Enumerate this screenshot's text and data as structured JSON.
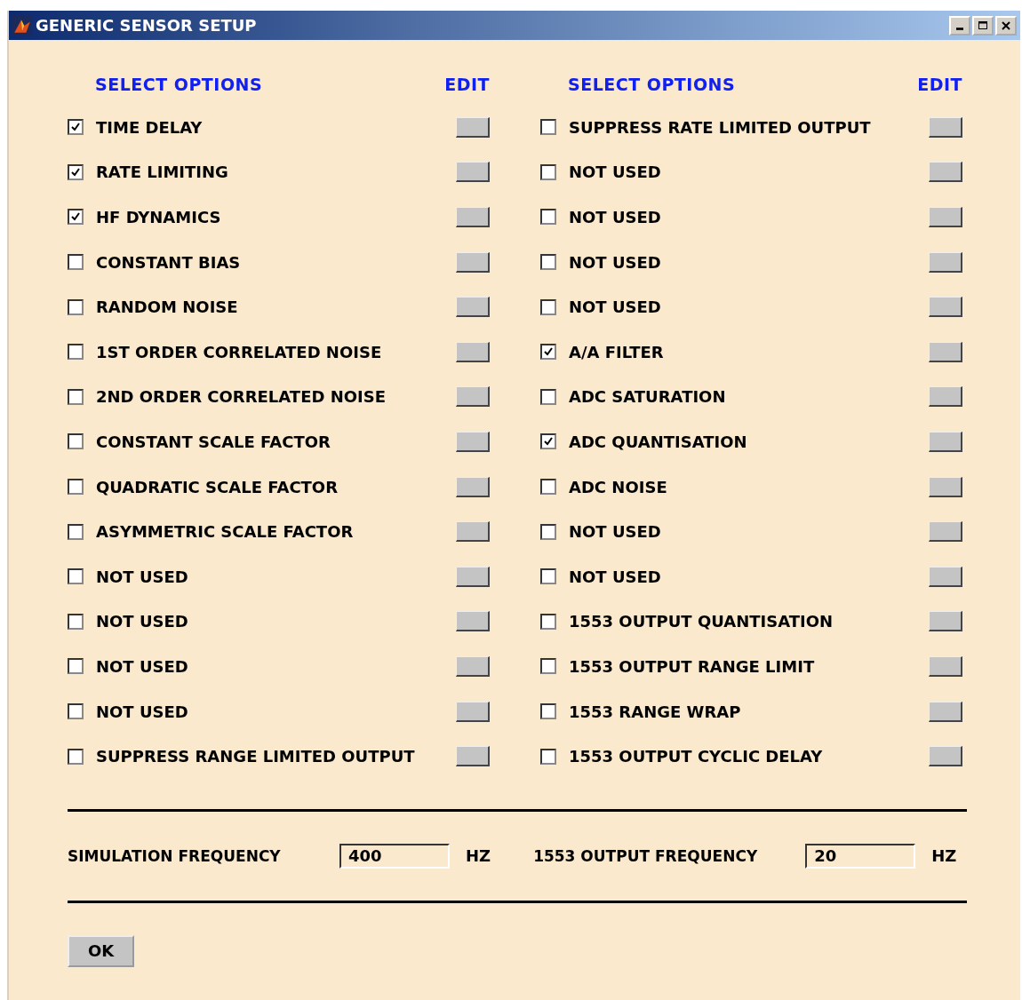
{
  "window": {
    "title": "GENERIC SENSOR SETUP"
  },
  "columns": [
    {
      "header": "SELECT OPTIONS",
      "edit_header": "EDIT",
      "options": [
        {
          "label": "TIME DELAY",
          "checked": true
        },
        {
          "label": "RATE LIMITING",
          "checked": true
        },
        {
          "label": "HF DYNAMICS",
          "checked": true
        },
        {
          "label": "CONSTANT BIAS",
          "checked": false
        },
        {
          "label": "RANDOM NOISE",
          "checked": false
        },
        {
          "label": "1ST ORDER CORRELATED NOISE",
          "checked": false
        },
        {
          "label": "2ND ORDER CORRELATED NOISE",
          "checked": false
        },
        {
          "label": "CONSTANT SCALE FACTOR",
          "checked": false
        },
        {
          "label": "QUADRATIC SCALE FACTOR",
          "checked": false
        },
        {
          "label": "ASYMMETRIC SCALE FACTOR",
          "checked": false
        },
        {
          "label": "NOT USED",
          "checked": false
        },
        {
          "label": "NOT USED",
          "checked": false
        },
        {
          "label": "NOT USED",
          "checked": false
        },
        {
          "label": "NOT USED",
          "checked": false
        },
        {
          "label": "SUPPRESS RANGE LIMITED OUTPUT",
          "checked": false
        }
      ]
    },
    {
      "header": "SELECT OPTIONS",
      "edit_header": "EDIT",
      "options": [
        {
          "label": "SUPPRESS RATE LIMITED OUTPUT",
          "checked": false
        },
        {
          "label": "NOT USED",
          "checked": false
        },
        {
          "label": "NOT USED",
          "checked": false
        },
        {
          "label": "NOT USED",
          "checked": false
        },
        {
          "label": "NOT USED",
          "checked": false
        },
        {
          "label": "A/A FILTER",
          "checked": true
        },
        {
          "label": "ADC SATURATION",
          "checked": false
        },
        {
          "label": "ADC QUANTISATION",
          "checked": true
        },
        {
          "label": "ADC NOISE",
          "checked": false
        },
        {
          "label": "NOT USED",
          "checked": false
        },
        {
          "label": "NOT USED",
          "checked": false
        },
        {
          "label": "1553 OUTPUT QUANTISATION",
          "checked": false
        },
        {
          "label": "1553 OUTPUT RANGE LIMIT",
          "checked": false
        },
        {
          "label": "1553 RANGE WRAP",
          "checked": false
        },
        {
          "label": "1553 OUTPUT CYCLIC DELAY",
          "checked": false
        }
      ]
    }
  ],
  "frequencies": [
    {
      "label": "SIMULATION FREQUENCY",
      "value": "400",
      "unit": "HZ"
    },
    {
      "label": "1553 OUTPUT FREQUENCY",
      "value": "20",
      "unit": "HZ"
    }
  ],
  "buttons": [
    "OK"
  ]
}
